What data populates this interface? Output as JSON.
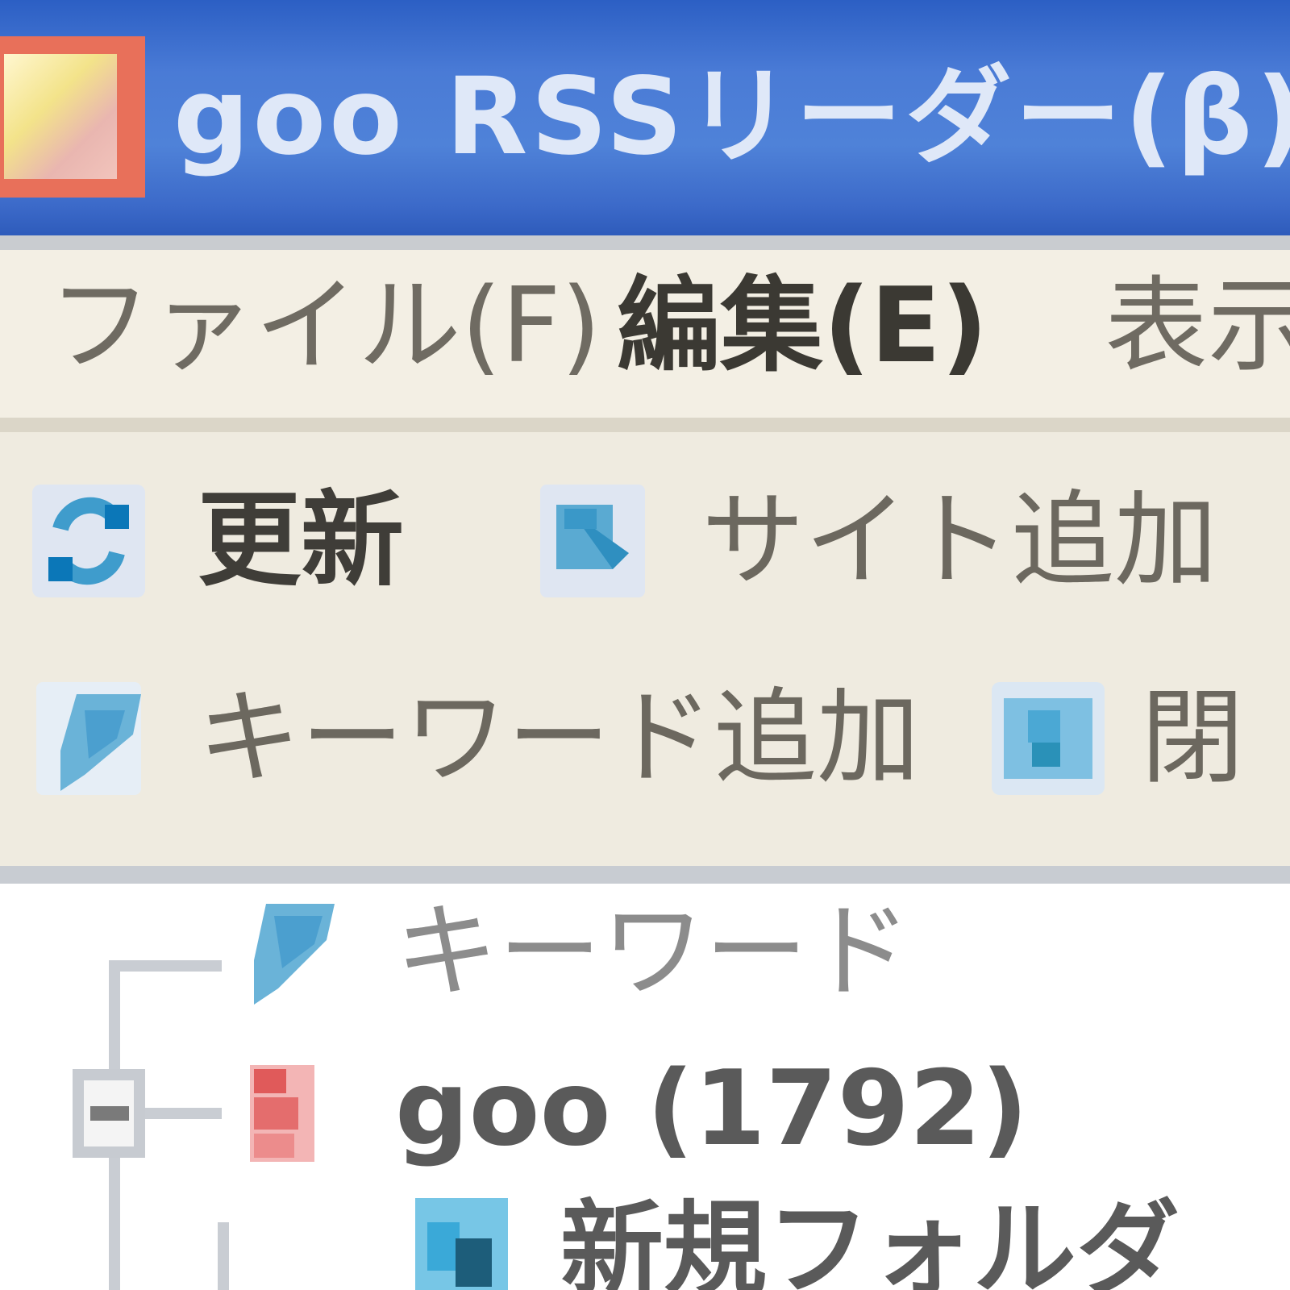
{
  "window": {
    "title": "goo RSSリーダー(β)",
    "icon": "app-icon"
  },
  "menubar": {
    "items": [
      {
        "label": "ファイル(F)"
      },
      {
        "label": "編集(E)"
      },
      {
        "label": "表示(V)"
      }
    ]
  },
  "toolbar": {
    "buttons": [
      {
        "label": "更新",
        "icon": "refresh-icon"
      },
      {
        "label": "サイト追加",
        "icon": "add-site-icon"
      },
      {
        "label": "キーワード追加",
        "icon": "add-keyword-icon"
      },
      {
        "label": "閉",
        "icon": "folder-icon"
      }
    ]
  },
  "tree": {
    "nodes": [
      {
        "label": "キーワード",
        "icon": "keyword-icon"
      },
      {
        "label": "goo (1792)",
        "icon": "goo-feed-icon"
      },
      {
        "label": "新規フォルダ",
        "icon": "folder-icon"
      }
    ]
  },
  "colors": {
    "titlebar": "#4a7bd6",
    "menubar": "#f3efe4",
    "toolbar": "#efebe0",
    "accent_icon": "#6ab3d8"
  }
}
